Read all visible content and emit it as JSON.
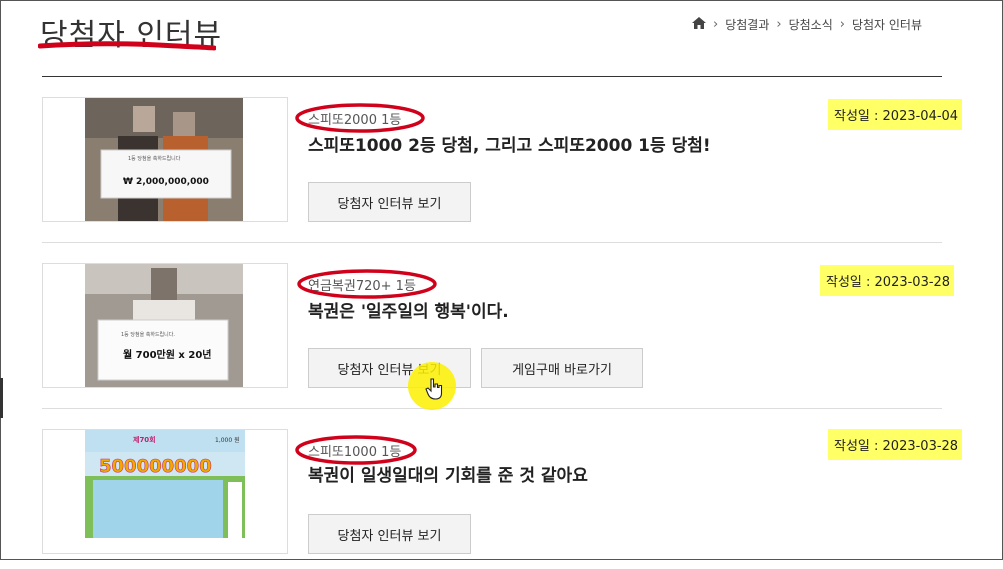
{
  "page": {
    "title": "당첨자 인터뷰"
  },
  "breadcrumb": {
    "home_icon": "home-icon",
    "items": [
      "당첨결과",
      "당첨소식",
      "당첨자 인터뷰"
    ]
  },
  "items": [
    {
      "badge": "스피또2000 1등",
      "title": "스피또1000 2등 당첨, 그리고 스피또2000 1등 당첨!",
      "date": "작성일 : 2023-04-04",
      "buttons": [
        "당첨자 인터뷰 보기"
      ],
      "thumb": {
        "board_text": "₩ 2,000,000,000",
        "board_small": "1등 당첨을 축하드립니다"
      }
    },
    {
      "badge": "연금복권720+ 1등",
      "title": "복권은 '일주일의 행복'이다.",
      "date": "작성일 : 2023-03-28",
      "buttons": [
        "당첨자 인터뷰 보기",
        "게임구매 바로가기"
      ],
      "thumb": {
        "board_text": "월 700만원 x 20년",
        "board_small": "1등 당첨을 축하드립니다."
      }
    },
    {
      "badge": "스피또1000 1등",
      "title": "복권이 일생일대의 기회를 준 것 같아요",
      "date": "작성일 : 2023-03-28",
      "buttons": [
        "당첨자 인터뷰 보기"
      ],
      "thumb": {
        "board_text": "500000000",
        "board_small": "1,000 원",
        "round": "제70회"
      }
    }
  ],
  "colors": {
    "highlight": "#ffff66",
    "annotation": "#d0021b",
    "button_bg": "#f3f3f3"
  }
}
